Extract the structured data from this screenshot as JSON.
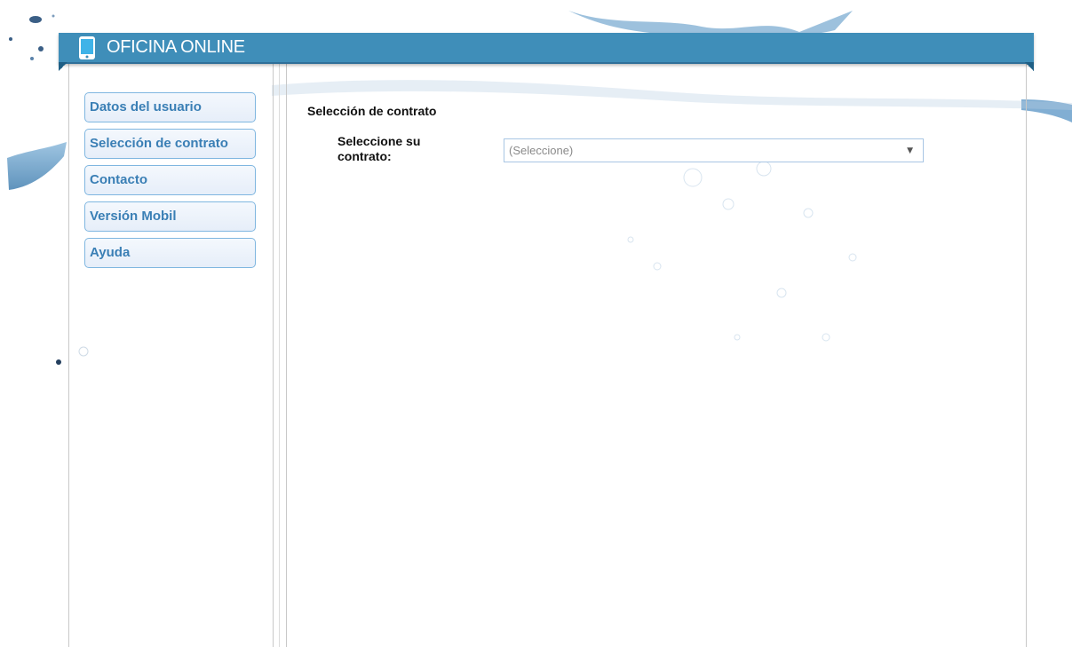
{
  "header": {
    "title": "OFICINA ONLINE",
    "icon": "mobile-phone-icon",
    "color": "#3f8eb9"
  },
  "sidebar": {
    "items": [
      {
        "label": "Datos del usuario"
      },
      {
        "label": "Selección de contrato"
      },
      {
        "label": "Contacto"
      },
      {
        "label": "Versión Mobil"
      },
      {
        "label": "Ayuda"
      }
    ],
    "accent": "#3a7fb5"
  },
  "main": {
    "section_title": "Selección de contrato",
    "contract_label": "Seleccione su contrato:",
    "contract_select": {
      "selected": "(Seleccione)",
      "icon": "dropdown-arrow-icon"
    }
  }
}
